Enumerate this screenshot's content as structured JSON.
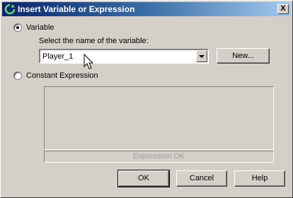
{
  "window": {
    "title": "Insert Variable or Expression",
    "close_label": "X"
  },
  "variable_option": {
    "label": "Variable",
    "checked": true
  },
  "variable_prompt": "Select the name of the variable:",
  "variable_select": {
    "selected": "Player_1"
  },
  "new_button": "New...",
  "constant_option": {
    "label": "Constant Expression",
    "checked": false
  },
  "expression": {
    "text": "",
    "status": "Expression OK"
  },
  "buttons": {
    "ok": "OK",
    "cancel": "Cancel",
    "help": "Help"
  }
}
